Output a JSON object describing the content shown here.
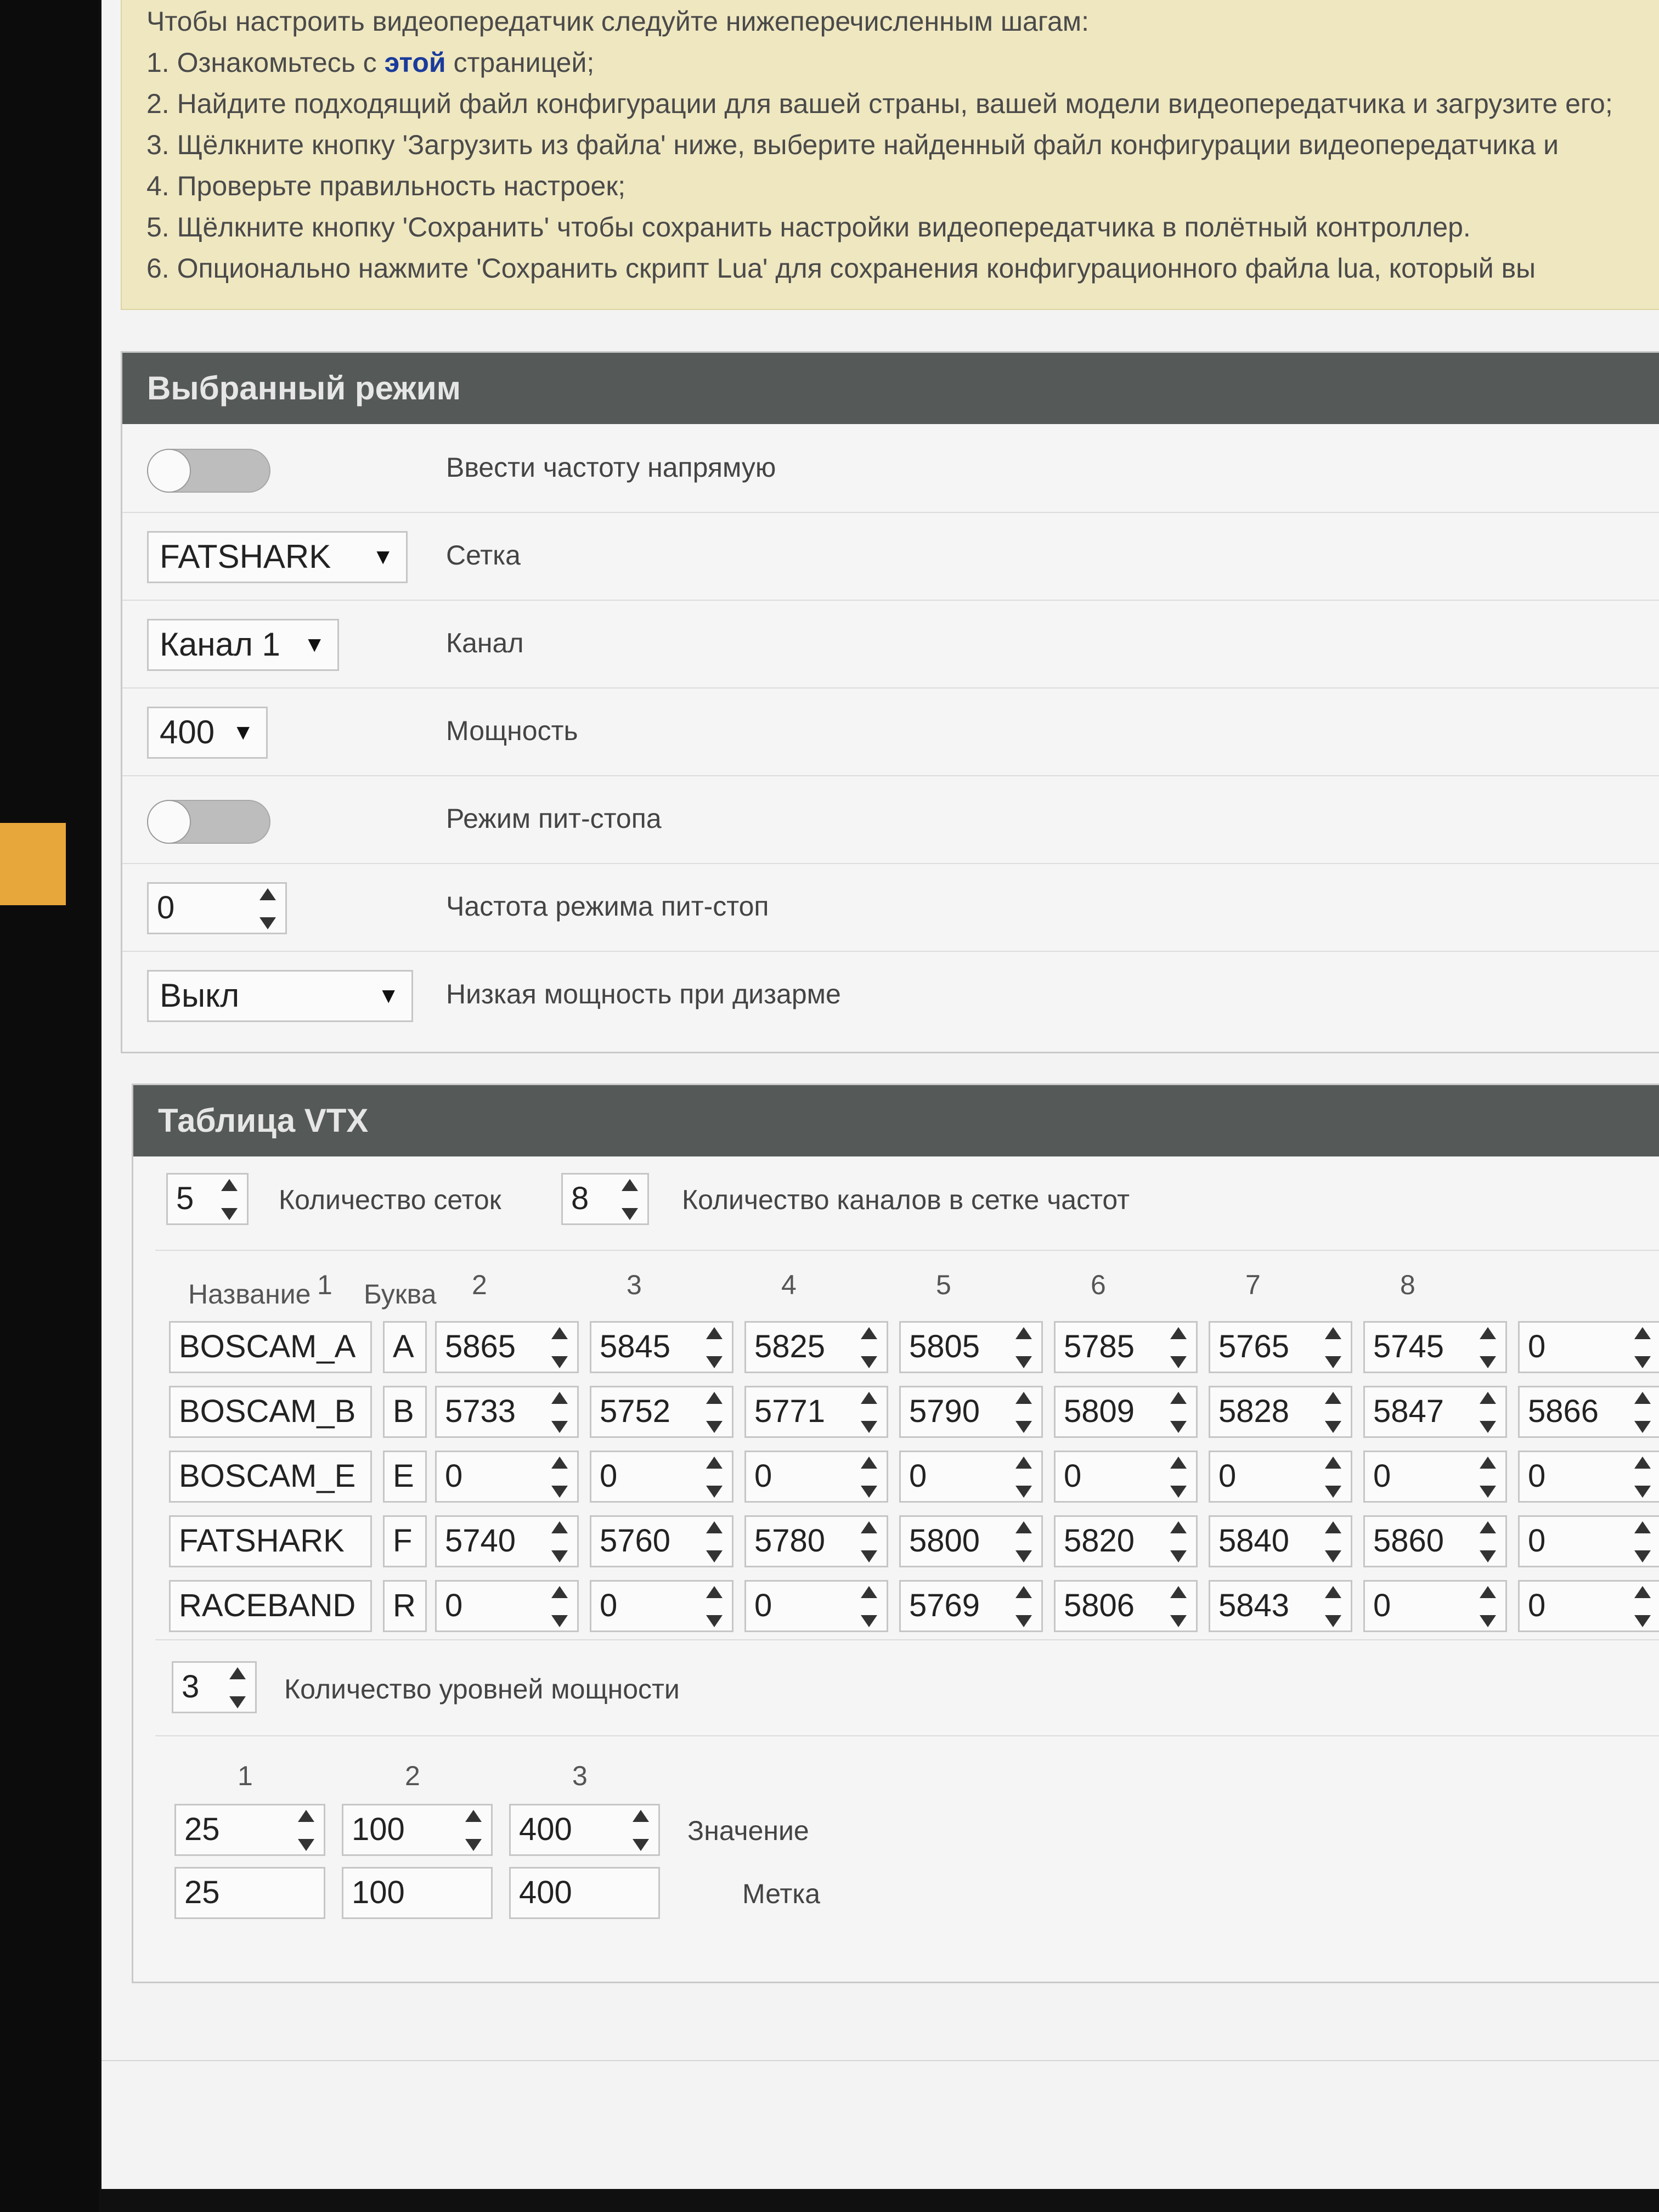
{
  "instructions": {
    "intro": "Чтобы настроить видеопередатчик следуйте нижеперечисленным шагам:",
    "step1_pre": "1. Ознакомьтесь с ",
    "step1_link": "этой",
    "step1_post": " страницей;",
    "step2": "2. Найдите подходящий файл конфигурации для вашей страны, вашей модели видеопередатчика и загрузите его;",
    "step3": "3. Щёлкните кнопку 'Загрузить из файла' ниже, выберите найденный файл конфигурации видеопередатчика и",
    "step4": "4. Проверьте правильность настроек;",
    "step5": "5. Щёлкните кнопку 'Сохранить' чтобы сохранить настройки видеопередатчика в полётный контроллер.",
    "step6": "6. Опционально нажмите 'Сохранить скрипт Lua' для сохранения конфигурационного файла lua, который вы"
  },
  "selected_mode": {
    "title": "Выбранный режим",
    "freq_direct_label": "Ввести частоту напрямую",
    "freq_direct_enabled": false,
    "band_value": "FATSHARK",
    "band_label": "Сетка",
    "channel_value": "Канал 1",
    "channel_label": "Канал",
    "power_value": "400",
    "power_label": "Мощность",
    "pit_mode_label": "Режим пит-стопа",
    "pit_mode_enabled": false,
    "pit_freq_value": "0",
    "pit_freq_label": "Частота режима пит-стоп",
    "low_power_value": "Выкл",
    "low_power_label": "Низкая мощность при дизарме"
  },
  "vtx_table": {
    "title": "Таблица VTX",
    "band_count": "5",
    "band_count_label": "Количество сеток",
    "channel_count": "8",
    "channel_count_label": "Количество каналов в сетке частот",
    "col_name": "Название",
    "col_letter": "Буква",
    "channel_headers": [
      "1",
      "2",
      "3",
      "4",
      "5",
      "6",
      "7",
      "8"
    ],
    "bands": [
      {
        "name": "BOSCAM_A",
        "letter": "A",
        "freqs": [
          "5865",
          "5845",
          "5825",
          "5805",
          "5785",
          "5765",
          "5745",
          "0"
        ]
      },
      {
        "name": "BOSCAM_B",
        "letter": "B",
        "freqs": [
          "5733",
          "5752",
          "5771",
          "5790",
          "5809",
          "5828",
          "5847",
          "5866"
        ]
      },
      {
        "name": "BOSCAM_E",
        "letter": "E",
        "freqs": [
          "0",
          "0",
          "0",
          "0",
          "0",
          "0",
          "0",
          "0"
        ]
      },
      {
        "name": "FATSHARK",
        "letter": "F",
        "freqs": [
          "5740",
          "5760",
          "5780",
          "5800",
          "5820",
          "5840",
          "5860",
          "0"
        ]
      },
      {
        "name": "RACEBAND",
        "letter": "R",
        "freqs": [
          "0",
          "0",
          "0",
          "5769",
          "5806",
          "5843",
          "0",
          "0"
        ]
      }
    ],
    "power_levels_count": "3",
    "power_levels_label": "Количество уровней мощности",
    "power_headers": [
      "1",
      "2",
      "3"
    ],
    "power_values": [
      "25",
      "100",
      "400"
    ],
    "power_value_label": "Значение",
    "power_labels": [
      "25",
      "100",
      "400"
    ],
    "power_label_label": "Метка"
  }
}
